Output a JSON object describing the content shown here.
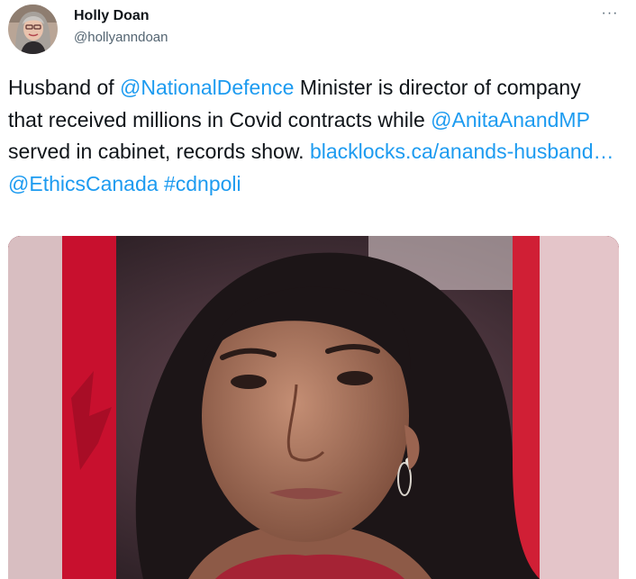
{
  "author": {
    "name": "Holly Doan",
    "handle": "@hollyanndoan",
    "avatar_icon": "profile-photo"
  },
  "menu": {
    "icon": "more-horizontal-icon",
    "glyph": "···"
  },
  "tweet": {
    "segments": [
      {
        "text": "Husband of ",
        "type": "text"
      },
      {
        "text": "@NationalDefence",
        "type": "mention"
      },
      {
        "text": " Minister is director of company that received millions in Covid contracts while ",
        "type": "text"
      },
      {
        "text": "@AnitaAnandMP",
        "type": "mention"
      },
      {
        "text": " served in cabinet, records show. ",
        "type": "text"
      },
      {
        "text": "blacklocks.ca/anands-husband…",
        "type": "link"
      },
      {
        "text": " ",
        "type": "text"
      },
      {
        "text": "@EthicsCanada",
        "type": "mention"
      },
      {
        "text": " ",
        "type": "text"
      },
      {
        "text": "#cdnpoli",
        "type": "hashtag"
      }
    ]
  },
  "media": {
    "type": "photo",
    "icon": "tweet-photo"
  },
  "colors": {
    "link": "#1d9bf0",
    "text": "#0f1419",
    "secondary": "#536471"
  }
}
